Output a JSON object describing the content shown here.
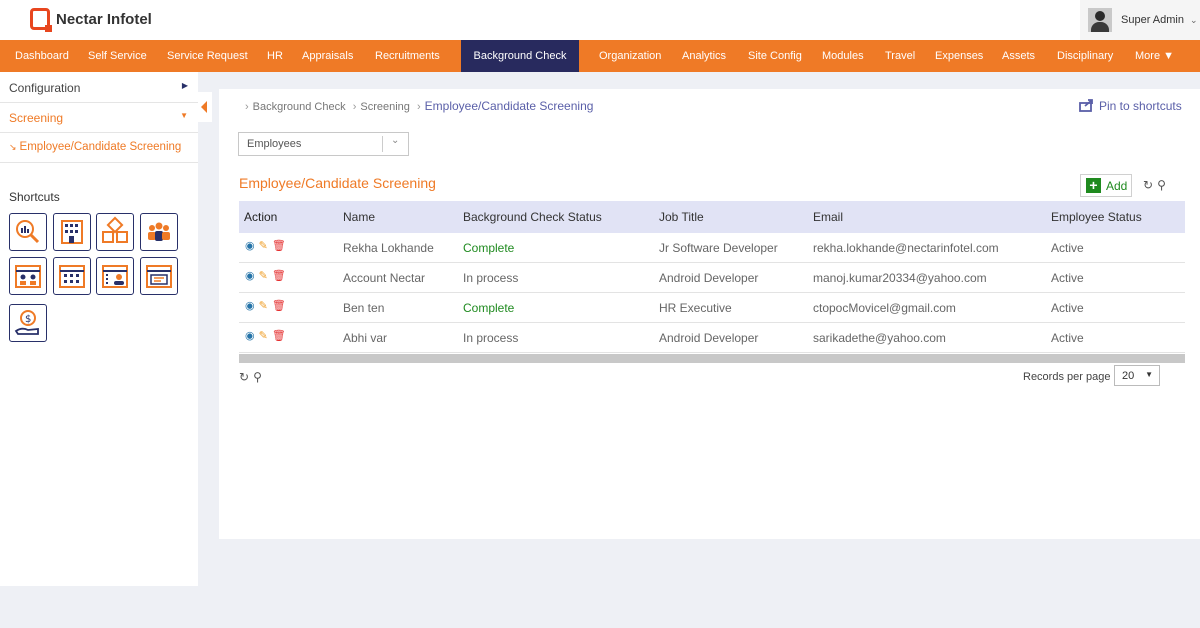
{
  "header": {
    "logo_text": "Nectar Infotel",
    "user_name": "Super Admin"
  },
  "nav": {
    "items": [
      "Dashboard",
      "Self Service",
      "Service Request",
      "HR",
      "Appraisals",
      "Recruitments",
      "Background Check",
      "Organization",
      "Analytics",
      "Site Config",
      "Modules",
      "Travel",
      "Expenses",
      "Assets",
      "Disciplinary",
      "More ▼"
    ],
    "active": "Background Check"
  },
  "sidebar": {
    "items": [
      {
        "label": "Configuration"
      },
      {
        "label": "Screening"
      },
      {
        "label": "Employee/Candidate Screening"
      }
    ],
    "shortcuts_title": "Shortcuts",
    "shortcut_icons": [
      "analytics-search-icon",
      "building-icon",
      "boxes-icon",
      "team-icon",
      "calendar-people-icon",
      "calendar-grid-icon",
      "calendar-person-icon",
      "calendar-card-icon",
      "money-hand-icon"
    ]
  },
  "breadcrumb": {
    "items": [
      "Background Check",
      "Screening"
    ],
    "current": "Employee/Candidate Screening"
  },
  "pin_label": "Pin to shortcuts",
  "filter": {
    "selected": "Employees"
  },
  "section_title": "Employee/Candidate Screening",
  "add_label": "Add",
  "table": {
    "columns": [
      "Action",
      "Name",
      "Background Check Status",
      "Job Title",
      "Email",
      "Employee Status"
    ],
    "rows": [
      {
        "name": "Rekha Lokhande",
        "status": "Complete",
        "job": "Jr Software Developer",
        "email": "rekha.lokhande@nectarinfotel.com",
        "emp_status": "Active"
      },
      {
        "name": "Account Nectar",
        "status": "In process",
        "job": "Android Developer",
        "email": "manoj.kumar20334@yahoo.com",
        "emp_status": "Active"
      },
      {
        "name": "Ben ten",
        "status": "Complete",
        "job": "HR Executive",
        "email": "ctopocMovicel@gmail.com",
        "emp_status": "Active"
      },
      {
        "name": "Abhi var",
        "status": "In process",
        "job": "Android Developer",
        "email": "sarikadethe@yahoo.com",
        "emp_status": "Active"
      }
    ]
  },
  "pagination": {
    "records_label": "Records per page",
    "records_value": "20"
  },
  "colors": {
    "brand_orange": "#ef7a26",
    "nav_active": "#282a5e",
    "complete_green": "#1f8a1f",
    "link_purple": "#5a5fa8"
  }
}
